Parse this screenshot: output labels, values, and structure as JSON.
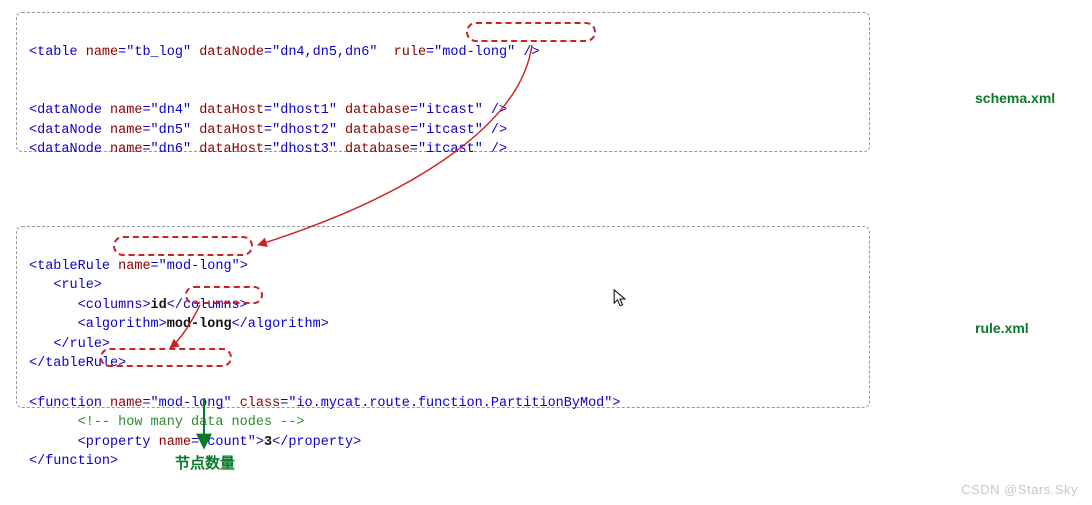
{
  "labels": {
    "schema": "schema.xml",
    "rule": "rule.xml",
    "nodeCount": "节点数量"
  },
  "watermark": "CSDN @Stars.Sky",
  "schema": {
    "table": {
      "name": "tb_log",
      "dataNode": "dn4,dn5,dn6",
      "rule": "mod-long"
    },
    "dataNodes": [
      {
        "name": "dn4",
        "dataHost": "dhost1",
        "database": "itcast"
      },
      {
        "name": "dn5",
        "dataHost": "dhost2",
        "database": "itcast"
      },
      {
        "name": "dn6",
        "dataHost": "dhost3",
        "database": "itcast"
      }
    ]
  },
  "ruleXml": {
    "tableRule": {
      "name": "mod-long",
      "columns": "id",
      "algorithm": "mod-long"
    },
    "function": {
      "name": "mod-long",
      "class": "io.mycat.route.function.PartitionByMod",
      "comment": "<!-- how many data nodes -->",
      "property": {
        "name": "count",
        "value": "3"
      }
    }
  }
}
